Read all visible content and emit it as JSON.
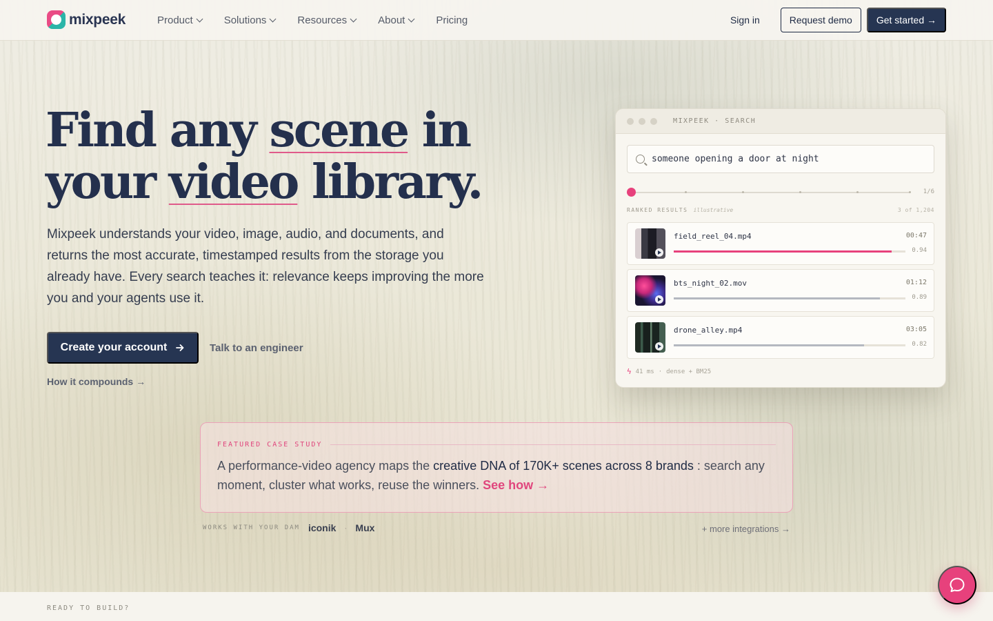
{
  "brand": {
    "name": "mixpeek"
  },
  "nav": {
    "links": [
      {
        "label": "Product",
        "dropdown": true
      },
      {
        "label": "Solutions",
        "dropdown": true
      },
      {
        "label": "Resources",
        "dropdown": true
      },
      {
        "label": "About",
        "dropdown": true
      },
      {
        "label": "Pricing",
        "dropdown": false
      }
    ],
    "sign_in": "Sign in",
    "request_demo": "Request demo",
    "get_started": "Get started →"
  },
  "hero": {
    "title_parts": [
      "Find any ",
      "scene",
      " in your ",
      "video",
      " library."
    ],
    "subtitle": "Mixpeek understands your video, image, audio, and documents, and returns the most accurate, timestamped results from the storage you already have. Every search teaches it: relevance keeps improving the more you and your agents use it.",
    "cta_primary": "Create your account",
    "cta_secondary": "Talk to an engineer",
    "how_link": "How it compounds →"
  },
  "search_card": {
    "header": "MIXPEEK · SEARCH",
    "query": "someone opening a door at night",
    "step_label": "1/6",
    "progress": 0.0,
    "ranked_label": "RANKED RESULTS",
    "ranked_note": "illustrative",
    "ranked_count": "3 of 1,204",
    "results": [
      {
        "filename": "field_reel_04.mp4",
        "time": "00:47",
        "score": "0.94",
        "score_value": 0.94,
        "bar_color": "#e7417c"
      },
      {
        "filename": "bts_night_02.mov",
        "time": "01:12",
        "score": "0.89",
        "score_value": 0.89,
        "bar_color": "#b4b8c0"
      },
      {
        "filename": "drone_alley.mp4",
        "time": "03:05",
        "score": "0.82",
        "score_value": 0.82,
        "bar_color": "#b4b8c0"
      }
    ],
    "footer_latency": "41 ms",
    "footer_sep": "·",
    "footer_mode": "dense + BM25"
  },
  "case_study": {
    "label": "FEATURED CASE STUDY",
    "text_before": "A performance-video agency maps the ",
    "text_strong": "creative DNA of 170K+ scenes across 8 brands",
    "text_after": " : search any moment, cluster what works, reuse the winners. ",
    "link": "See how →"
  },
  "dam": {
    "label": "WORKS WITH YOUR DAM",
    "items": [
      "iconik",
      "Mux"
    ],
    "separator": "·",
    "more": "+ more integrations →"
  },
  "bottom": {
    "ready": "READY TO BUILD?"
  },
  "colors": {
    "accent": "#e7417c",
    "navy": "#263552",
    "teal": "#2bb5a8"
  },
  "icons": {
    "search": "search-icon",
    "chat": "chat-bubble-icon",
    "bolt": "bolt-icon",
    "play": "play-icon"
  }
}
